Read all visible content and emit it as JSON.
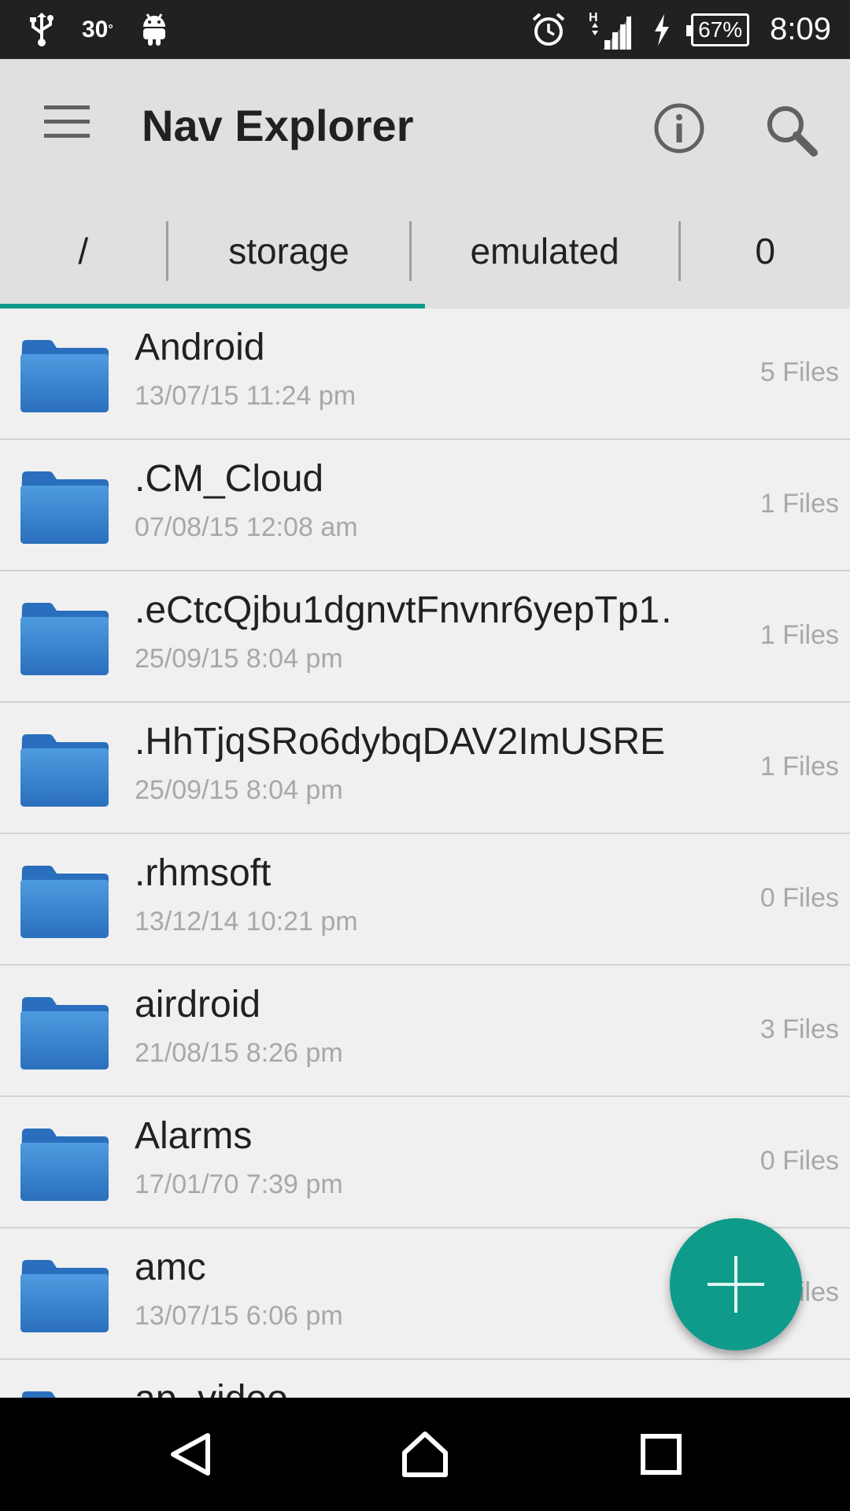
{
  "status_bar": {
    "temperature": "30",
    "temperature_unit": "°",
    "battery": "67%",
    "time": "8:09",
    "icons": [
      "usb-icon",
      "android-icon",
      "alarm-icon",
      "signal-icon",
      "charging-icon"
    ]
  },
  "app_bar": {
    "title": "Nav Explorer",
    "icons": [
      "menu-icon",
      "info-icon",
      "search-icon"
    ]
  },
  "breadcrumb": {
    "items": [
      "/",
      "storage",
      "emulated",
      "0"
    ]
  },
  "files": [
    {
      "name": "Android",
      "date": "13/07/15 11:24 pm",
      "count": "5 Files"
    },
    {
      "name": ".CM_Cloud",
      "date": "07/08/15 12:08 am",
      "count": "1 Files"
    },
    {
      "name": ".eCtcQjbu1dgnvtFnvnr6yepTp1…",
      "date": "25/09/15 8:04 pm",
      "count": "1 Files"
    },
    {
      "name": ".HhTjqSRo6dybqDAV2ImUSRE…",
      "date": "25/09/15 8:04 pm",
      "count": "1 Files"
    },
    {
      "name": ".rhmsoft",
      "date": "13/12/14 10:21 pm",
      "count": "0 Files"
    },
    {
      "name": "airdroid",
      "date": "21/08/15 8:26 pm",
      "count": "3 Files"
    },
    {
      "name": "Alarms",
      "date": "17/01/70 7:39 pm",
      "count": "0 Files"
    },
    {
      "name": "amc",
      "date": "13/07/15 6:06 pm",
      "count": "Files"
    },
    {
      "name": "ap_video",
      "date": "",
      "count": ""
    }
  ],
  "colors": {
    "accent": "#0e9b8a",
    "folder": "#3a86d1",
    "app_bar": "#e0e0e0",
    "status_bar": "#212121"
  }
}
